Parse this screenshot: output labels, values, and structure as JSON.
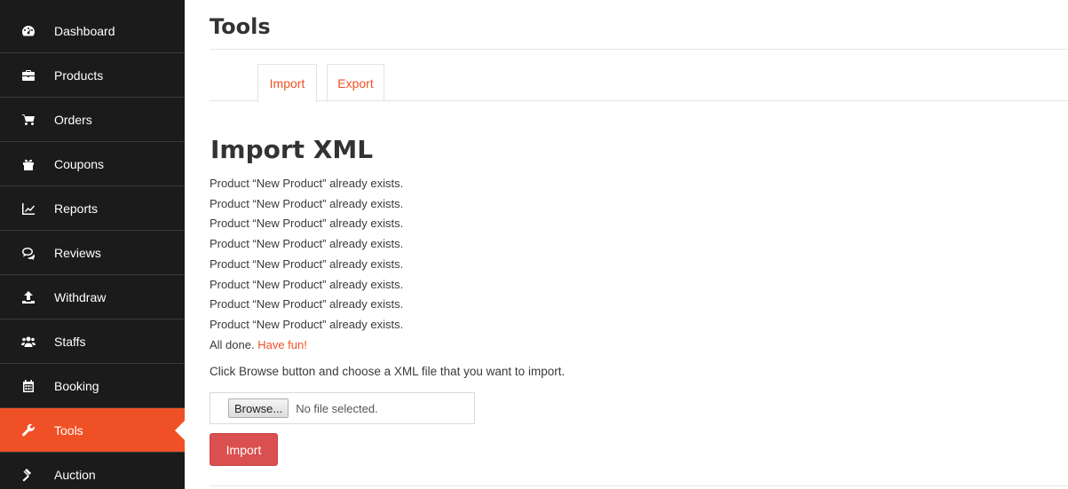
{
  "sidebar": {
    "items": [
      {
        "label": "Dashboard",
        "icon": "dashboard-icon"
      },
      {
        "label": "Products",
        "icon": "briefcase-icon"
      },
      {
        "label": "Orders",
        "icon": "cart-icon"
      },
      {
        "label": "Coupons",
        "icon": "gift-icon"
      },
      {
        "label": "Reports",
        "icon": "line-chart-icon"
      },
      {
        "label": "Reviews",
        "icon": "comments-icon"
      },
      {
        "label": "Withdraw",
        "icon": "upload-icon"
      },
      {
        "label": "Staffs",
        "icon": "users-icon"
      },
      {
        "label": "Booking",
        "icon": "calendar-icon"
      },
      {
        "label": "Tools",
        "icon": "wrench-icon",
        "active": true
      },
      {
        "label": "Auction",
        "icon": "gavel-icon"
      }
    ]
  },
  "header": {
    "title": "Tools"
  },
  "tabs": [
    {
      "label": "Import",
      "active": true
    },
    {
      "label": "Export",
      "active": false
    }
  ],
  "import_section": {
    "title": "Import XML",
    "messages": [
      "Product “New Product” already exists.",
      "Product “New Product” already exists.",
      "Product “New Product” already exists.",
      "Product “New Product” already exists.",
      "Product “New Product” already exists.",
      "Product “New Product” already exists.",
      "Product “New Product” already exists.",
      "Product “New Product” already exists."
    ],
    "done_text": "All done.",
    "done_link": "Have fun!",
    "instruction": "Click Browse button and choose a XML file that you want to import.",
    "browse_label": "Browse...",
    "file_status": "No file selected.",
    "import_button": "Import"
  },
  "colors": {
    "accent": "#f05025",
    "sidebar_bg": "#1b1b1b",
    "import_button": "#da4f4f"
  }
}
